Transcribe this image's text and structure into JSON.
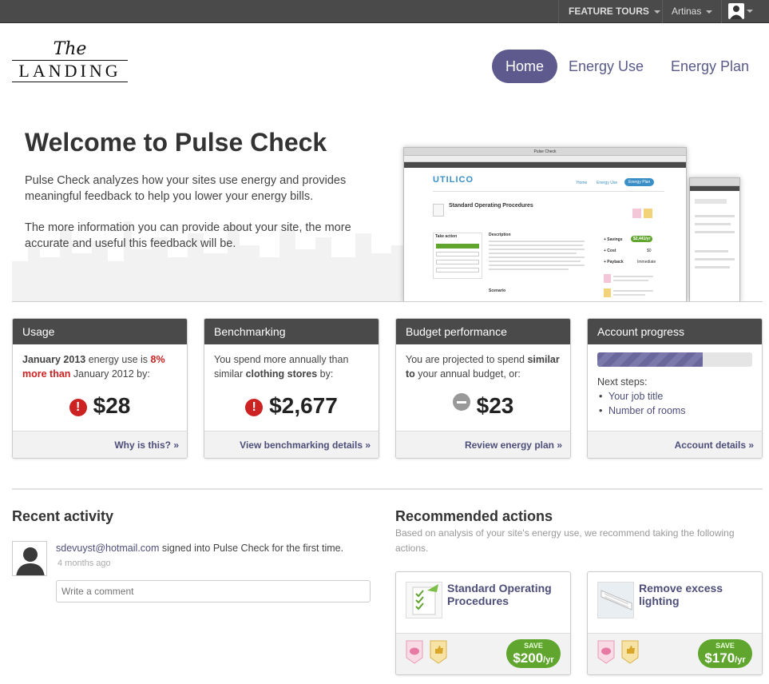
{
  "topbar": {
    "feature_tours": "FEATURE TOURS",
    "user_name": "Artinas"
  },
  "logo": {
    "line1": "The",
    "line2": "LANDING"
  },
  "nav": {
    "home": "Home",
    "energy_use": "Energy Use",
    "energy_plan": "Energy Plan"
  },
  "hero": {
    "title": "Welcome to Pulse Check",
    "para1": "Pulse Check analyzes how your sites use energy and provides meaningful feedback to help you lower your energy bills.",
    "para2": "The more information you can provide about your site, the more accurate and useful this feedback will be.",
    "mock": {
      "window_title": "Pulse Check",
      "brand": "UTILICO",
      "nav": [
        "Home",
        "Energy Use",
        "Energy Plan"
      ],
      "heading": "Standard Operating Procedures",
      "take_action": "Take action",
      "description": "Description",
      "savings": "+ Savings",
      "savings_value": "$2,441/yr",
      "cost": "+ Cost",
      "cost_value": "$0",
      "payback": "+ Payback",
      "payback_value": "Immediate",
      "scenario": "Scenario"
    }
  },
  "cards": {
    "usage": {
      "title": "Usage",
      "period": "January 2013",
      "text1": " energy use is ",
      "pct": "8% more than",
      "text2": " January 2012 by:",
      "amount": "$28",
      "link": "Why is this? »"
    },
    "benchmarking": {
      "title": "Benchmarking",
      "text1": "You spend more annually than similar ",
      "emph": "clothing stores",
      "text2": " by:",
      "amount": "$2,677",
      "link": "View benchmarking details »"
    },
    "budget": {
      "title": "Budget performance",
      "text1": "You are projected to spend ",
      "emph": "similar to",
      "text2": " your annual budget, or:",
      "amount": "$23",
      "link": "Review energy plan »"
    },
    "account": {
      "title": "Account progress",
      "progress": 0.68,
      "next_steps": "Next steps:",
      "steps": [
        "Your job title",
        "Number of rooms"
      ],
      "link": "Account details »"
    }
  },
  "recent": {
    "title": "Recent activity",
    "email": "sdevuyst@hotmail.com",
    "action": " signed into Pulse Check for the first time.",
    "ago": "4 months ago",
    "comment_placeholder": "Write a comment"
  },
  "recommended": {
    "title": "Recommended actions",
    "subtitle": "Based on analysis of your site's energy use, we recommend taking the following actions.",
    "items": [
      {
        "title": "Standard Operating Procedures",
        "save_label": "SAVE",
        "save_amount": "$200",
        "save_unit": "/yr"
      },
      {
        "title": "Remove excess lighting",
        "save_label": "SAVE",
        "save_amount": "$170",
        "save_unit": "/yr"
      }
    ]
  },
  "colors": {
    "accent": "#5e5a8e",
    "alert": "#cc2222",
    "save_green": "#5fa52e",
    "feature_tours": "#f39c12"
  }
}
